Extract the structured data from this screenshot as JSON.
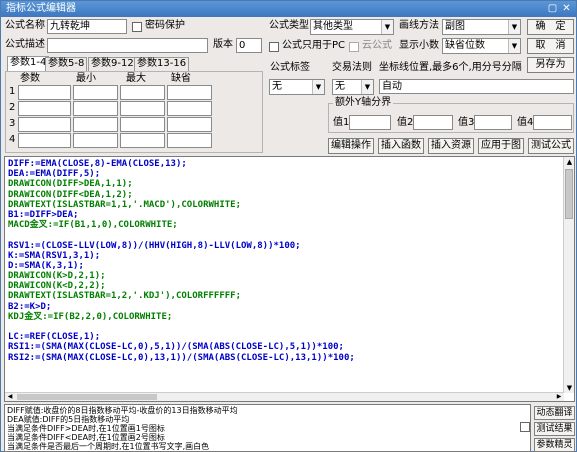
{
  "window": {
    "title": "指标公式编辑器",
    "minimize": "▢",
    "close": "✕"
  },
  "form": {
    "name_label": "公式名称",
    "name_value": "九转乾坤",
    "password_label": "密码保护",
    "desc_label": "公式描述",
    "desc_value": "",
    "version_label": "版本",
    "version_value": "0",
    "type_label": "公式类型",
    "type_value": "其他类型",
    "draw_label": "画线方法",
    "draw_value": "副图",
    "pc_only_label": "公式只用于PC",
    "cloud_label": "云公式",
    "decimal_label": "显示小数",
    "decimal_value": "缺省位数",
    "confirm": "确　定",
    "cancel": "取　消",
    "save_as": "另存为"
  },
  "param_tabs": [
    "参数1-4",
    "参数5-8",
    "参数9-12",
    "参数13-16"
  ],
  "param_headers": [
    "参数",
    "最小",
    "最大",
    "缺省"
  ],
  "param_rows": [
    "1",
    "2",
    "3",
    "4"
  ],
  "right": {
    "tag_label": "公式标签",
    "tag_value": "无",
    "trade_label": "交易法则",
    "trade_value": "无",
    "coord_label": "坐标线位置,最多6个,用分号分隔",
    "coord_value": "自动",
    "extra_axis_title": "额外Y轴分界",
    "axis_labels": [
      "值1",
      "值2",
      "值3",
      "值4"
    ],
    "buttons": [
      "编辑操作",
      "插入函数",
      "插入资源",
      "应用于图",
      "测试公式"
    ]
  },
  "code_lines": [
    [
      {
        "t": "DIFF:=EMA(CLOSE,8)-EMA(CLOSE,13);",
        "c": "blue"
      }
    ],
    [
      {
        "t": "DEA:=EMA(DIFF,5);",
        "c": "blue"
      }
    ],
    [
      {
        "t": "DRAWICON(DIFF>DEA,1,1);",
        "c": "green"
      }
    ],
    [
      {
        "t": "DRAWICON(DIFF<DEA,1,2);",
        "c": "green"
      }
    ],
    [
      {
        "t": "DRAWTEXT(ISLASTBAR=1,1,'.MACD'),COLORWHITE;",
        "c": "green"
      }
    ],
    [
      {
        "t": "B1:=DIFF>DEA;",
        "c": "blue"
      }
    ],
    [
      {
        "t": "MACD金叉:=IF(B1,1,0),COLORWHITE;",
        "c": "green"
      }
    ],
    [],
    [
      {
        "t": "RSV1:=(CLOSE-LLV(LOW,8))/(HHV(HIGH,8)-LLV(LOW,8))*100;",
        "c": "blue"
      }
    ],
    [
      {
        "t": "K:=SMA(RSV1,3,1);",
        "c": "blue"
      }
    ],
    [
      {
        "t": "D:=SMA(K,3,1);",
        "c": "blue"
      }
    ],
    [
      {
        "t": "DRAWICON(K>D,2,1);",
        "c": "green"
      }
    ],
    [
      {
        "t": "DRAWICON(K<D,2,2);",
        "c": "green"
      }
    ],
    [
      {
        "t": "DRAWTEXT(ISLASTBAR=1,2,'.KDJ'),COLORFFFFFF;",
        "c": "green"
      }
    ],
    [
      {
        "t": "B2:=K>D;",
        "c": "blue"
      }
    ],
    [
      {
        "t": "KDJ金叉:=IF(B2,2,0),COLORWHITE;",
        "c": "green"
      }
    ],
    [],
    [
      {
        "t": "LC:=REF(CLOSE,1);",
        "c": "blue"
      }
    ],
    [
      {
        "t": "RSI1:=(SMA(MAX(CLOSE-LC,0),5,1))/(SMA(ABS(CLOSE-LC),5,1))*100;",
        "c": "blue"
      }
    ],
    [
      {
        "t": "RSI2:=(SMA(MAX(CLOSE-LC,0),13,1))/(SMA(ABS(CLOSE-LC),13,1))*100;",
        "c": "blue"
      }
    ]
  ],
  "messages": [
    "DIFF赋值:收盘价的8日指数移动平均-收盘价的13日指数移动平均",
    "DEA赋值:DIFF的5日指数移动平均",
    "当满足条件DIFF>DEA时,在1位置画1号图标",
    "当满足条件DIFF<DEA时,在1位置画2号图标",
    "当满足条件是否最后一个周期时,在1位置书写文字,画白色"
  ],
  "side_buttons": [
    "动态翻译",
    "测试结果",
    "参数精灵"
  ]
}
